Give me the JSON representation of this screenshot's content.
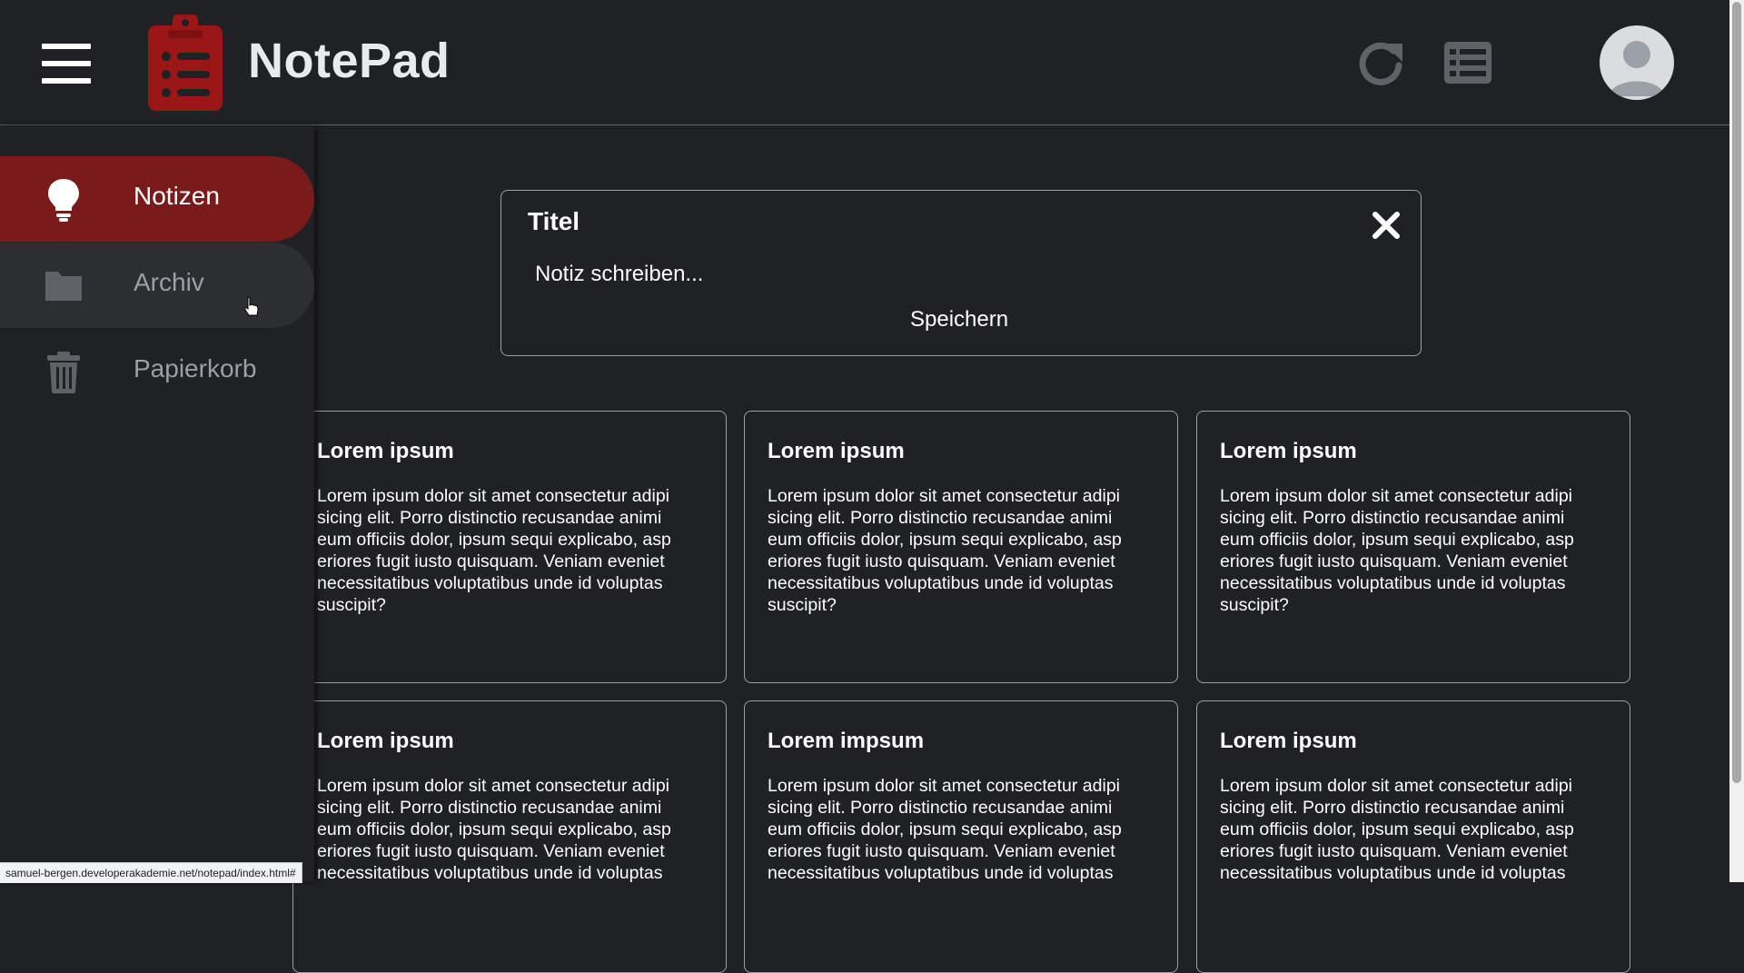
{
  "header": {
    "title": "NotePad",
    "menu_icon": "hamburger-menu-icon",
    "logo_icon": "clipboard-list-icon",
    "refresh_icon": "refresh-icon",
    "list_view_icon": "list-view-icon",
    "avatar_icon": "user-avatar-icon",
    "brand_color": "#9b1616"
  },
  "sidebar": {
    "items": [
      {
        "label": "Notizen",
        "icon": "lightbulb-icon",
        "state": "active"
      },
      {
        "label": "Archiv",
        "icon": "folder-icon",
        "state": "hover"
      },
      {
        "label": "Papierkorb",
        "icon": "trash-icon",
        "state": "normal"
      }
    ],
    "active_color": "#7a1a1a"
  },
  "editor": {
    "title_placeholder": "Titel",
    "body_placeholder": "Notiz schreiben...",
    "save_label": "Speichern",
    "close_icon": "close-icon"
  },
  "notes": [
    {
      "title": "Lorem ipsum",
      "text": "Lorem ipsum dolor sit amet consectetur adipi sicing elit. Porro distinctio recusandae animi eum officiis dolor, ipsum sequi explicabo, asp eriores fugit iusto quisquam. Veniam eveniet necessitatibus voluptatibus unde id voluptas suscipit?"
    },
    {
      "title": "Lorem ipsum",
      "text": "Lorem ipsum dolor sit amet consectetur adipi sicing elit. Porro distinctio recusandae animi eum officiis dolor, ipsum sequi explicabo, asp eriores fugit iusto quisquam. Veniam eveniet necessitatibus voluptatibus unde id voluptas suscipit?"
    },
    {
      "title": "Lorem ipsum",
      "text": "Lorem ipsum dolor sit amet consectetur adipi sicing elit. Porro distinctio recusandae animi eum officiis dolor, ipsum sequi explicabo, asp eriores fugit iusto quisquam. Veniam eveniet necessitatibus voluptatibus unde id voluptas suscipit?"
    },
    {
      "title": "Lorem ipsum",
      "text": "Lorem ipsum dolor sit amet consectetur adipi sicing elit. Porro distinctio recusandae animi eum officiis dolor, ipsum sequi explicabo, asp eriores fugit iusto quisquam. Veniam eveniet necessitatibus voluptatibus unde id voluptas"
    },
    {
      "title": "Lorem impsum",
      "text": "Lorem ipsum dolor sit amet consectetur adipi sicing elit. Porro distinctio recusandae animi eum officiis dolor, ipsum sequi explicabo, asp eriores fugit iusto quisquam. Veniam eveniet necessitatibus voluptatibus unde id voluptas"
    },
    {
      "title": "Lorem ipsum",
      "text": "Lorem ipsum dolor sit amet consectetur adipi sicing elit. Porro distinctio recusandae animi eum officiis dolor, ipsum sequi explicabo, asp eriores fugit iusto quisquam. Veniam eveniet necessitatibus voluptatibus unde id voluptas"
    }
  ],
  "statusbar": {
    "url": "samuel-bergen.developerakademie.net/notepad/index.html#"
  }
}
